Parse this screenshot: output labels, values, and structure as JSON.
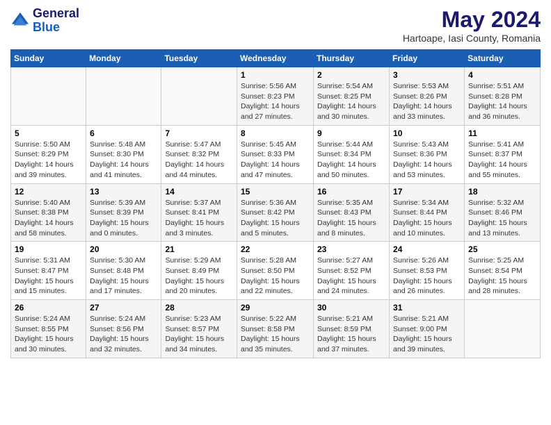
{
  "header": {
    "logo_line1": "General",
    "logo_line2": "Blue",
    "main_title": "May 2024",
    "subtitle": "Hartoape, Iasi County, Romania"
  },
  "weekdays": [
    "Sunday",
    "Monday",
    "Tuesday",
    "Wednesday",
    "Thursday",
    "Friday",
    "Saturday"
  ],
  "weeks": [
    [
      {
        "day": "",
        "info": ""
      },
      {
        "day": "",
        "info": ""
      },
      {
        "day": "",
        "info": ""
      },
      {
        "day": "1",
        "info": "Sunrise: 5:56 AM\nSunset: 8:23 PM\nDaylight: 14 hours and 27 minutes."
      },
      {
        "day": "2",
        "info": "Sunrise: 5:54 AM\nSunset: 8:25 PM\nDaylight: 14 hours and 30 minutes."
      },
      {
        "day": "3",
        "info": "Sunrise: 5:53 AM\nSunset: 8:26 PM\nDaylight: 14 hours and 33 minutes."
      },
      {
        "day": "4",
        "info": "Sunrise: 5:51 AM\nSunset: 8:28 PM\nDaylight: 14 hours and 36 minutes."
      }
    ],
    [
      {
        "day": "5",
        "info": "Sunrise: 5:50 AM\nSunset: 8:29 PM\nDaylight: 14 hours and 39 minutes."
      },
      {
        "day": "6",
        "info": "Sunrise: 5:48 AM\nSunset: 8:30 PM\nDaylight: 14 hours and 41 minutes."
      },
      {
        "day": "7",
        "info": "Sunrise: 5:47 AM\nSunset: 8:32 PM\nDaylight: 14 hours and 44 minutes."
      },
      {
        "day": "8",
        "info": "Sunrise: 5:45 AM\nSunset: 8:33 PM\nDaylight: 14 hours and 47 minutes."
      },
      {
        "day": "9",
        "info": "Sunrise: 5:44 AM\nSunset: 8:34 PM\nDaylight: 14 hours and 50 minutes."
      },
      {
        "day": "10",
        "info": "Sunrise: 5:43 AM\nSunset: 8:36 PM\nDaylight: 14 hours and 53 minutes."
      },
      {
        "day": "11",
        "info": "Sunrise: 5:41 AM\nSunset: 8:37 PM\nDaylight: 14 hours and 55 minutes."
      }
    ],
    [
      {
        "day": "12",
        "info": "Sunrise: 5:40 AM\nSunset: 8:38 PM\nDaylight: 14 hours and 58 minutes."
      },
      {
        "day": "13",
        "info": "Sunrise: 5:39 AM\nSunset: 8:39 PM\nDaylight: 15 hours and 0 minutes."
      },
      {
        "day": "14",
        "info": "Sunrise: 5:37 AM\nSunset: 8:41 PM\nDaylight: 15 hours and 3 minutes."
      },
      {
        "day": "15",
        "info": "Sunrise: 5:36 AM\nSunset: 8:42 PM\nDaylight: 15 hours and 5 minutes."
      },
      {
        "day": "16",
        "info": "Sunrise: 5:35 AM\nSunset: 8:43 PM\nDaylight: 15 hours and 8 minutes."
      },
      {
        "day": "17",
        "info": "Sunrise: 5:34 AM\nSunset: 8:44 PM\nDaylight: 15 hours and 10 minutes."
      },
      {
        "day": "18",
        "info": "Sunrise: 5:32 AM\nSunset: 8:46 PM\nDaylight: 15 hours and 13 minutes."
      }
    ],
    [
      {
        "day": "19",
        "info": "Sunrise: 5:31 AM\nSunset: 8:47 PM\nDaylight: 15 hours and 15 minutes."
      },
      {
        "day": "20",
        "info": "Sunrise: 5:30 AM\nSunset: 8:48 PM\nDaylight: 15 hours and 17 minutes."
      },
      {
        "day": "21",
        "info": "Sunrise: 5:29 AM\nSunset: 8:49 PM\nDaylight: 15 hours and 20 minutes."
      },
      {
        "day": "22",
        "info": "Sunrise: 5:28 AM\nSunset: 8:50 PM\nDaylight: 15 hours and 22 minutes."
      },
      {
        "day": "23",
        "info": "Sunrise: 5:27 AM\nSunset: 8:52 PM\nDaylight: 15 hours and 24 minutes."
      },
      {
        "day": "24",
        "info": "Sunrise: 5:26 AM\nSunset: 8:53 PM\nDaylight: 15 hours and 26 minutes."
      },
      {
        "day": "25",
        "info": "Sunrise: 5:25 AM\nSunset: 8:54 PM\nDaylight: 15 hours and 28 minutes."
      }
    ],
    [
      {
        "day": "26",
        "info": "Sunrise: 5:24 AM\nSunset: 8:55 PM\nDaylight: 15 hours and 30 minutes."
      },
      {
        "day": "27",
        "info": "Sunrise: 5:24 AM\nSunset: 8:56 PM\nDaylight: 15 hours and 32 minutes."
      },
      {
        "day": "28",
        "info": "Sunrise: 5:23 AM\nSunset: 8:57 PM\nDaylight: 15 hours and 34 minutes."
      },
      {
        "day": "29",
        "info": "Sunrise: 5:22 AM\nSunset: 8:58 PM\nDaylight: 15 hours and 35 minutes."
      },
      {
        "day": "30",
        "info": "Sunrise: 5:21 AM\nSunset: 8:59 PM\nDaylight: 15 hours and 37 minutes."
      },
      {
        "day": "31",
        "info": "Sunrise: 5:21 AM\nSunset: 9:00 PM\nDaylight: 15 hours and 39 minutes."
      },
      {
        "day": "",
        "info": ""
      }
    ]
  ]
}
